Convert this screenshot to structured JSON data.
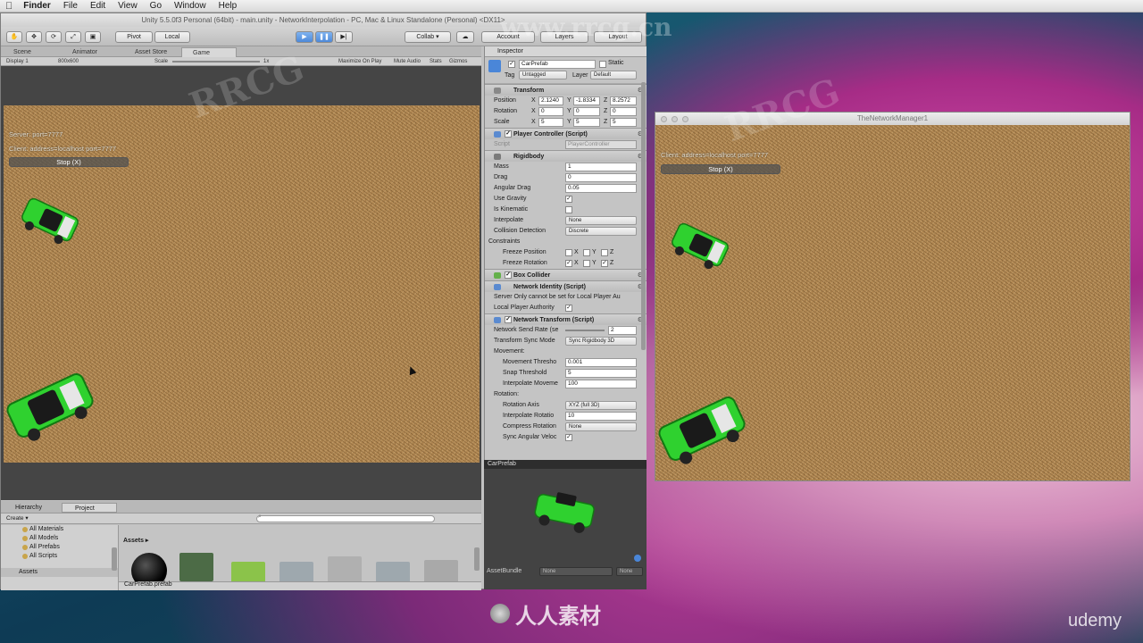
{
  "menubar": {
    "app": "Finder",
    "items": [
      "File",
      "Edit",
      "View",
      "Go",
      "Window",
      "Help"
    ]
  },
  "unity": {
    "window_title": "Unity 5.5.0f3 Personal (64bit) - main.unity - NetworkInterpolation - PC, Mac & Linux Standalone (Personal) <DX11>",
    "toolbar": {
      "pivot": "Pivot",
      "local": "Local",
      "collab": "Collab ▾",
      "account": "Account",
      "layers": "Layers",
      "layout": "Layout"
    },
    "tabs": {
      "scene": "Scene",
      "animator": "Animator",
      "asset_store": "Asset Store",
      "game": "Game"
    },
    "gamebar": {
      "display": "Display 1",
      "resolution": "800x600",
      "scale_label": "Scale",
      "scale_value": "1x",
      "maximize": "Maximize On Play",
      "mute": "Mute Audio",
      "stats": "Stats",
      "gizmos": "Gizmos"
    },
    "game_hud": {
      "server": "Server: port=7777",
      "client": "Client: address=localhost port=7777",
      "stop": "Stop (X)"
    }
  },
  "inspector": {
    "tab": "Inspector",
    "object_name": "CarPrefab",
    "static_label": "Static",
    "tag_label": "Tag",
    "tag_value": "Untagged",
    "layer_label": "Layer",
    "layer_value": "Default",
    "transform": {
      "title": "Transform",
      "position_label": "Position",
      "rotation_label": "Rotation",
      "scale_label": "Scale",
      "position": [
        "2.1240",
        "-1.8334",
        "8.2572"
      ],
      "rotation": [
        "0",
        "0",
        "0"
      ],
      "scale": [
        "5",
        "5",
        "5"
      ]
    },
    "player_controller": {
      "title": "Player Controller (Script)",
      "script_label": "Script",
      "script_value": "PlayerController"
    },
    "rigidbody": {
      "title": "Rigidbody",
      "mass_label": "Mass",
      "mass": "1",
      "drag_label": "Drag",
      "drag": "0",
      "angular_drag_label": "Angular Drag",
      "angular_drag": "0.05",
      "use_gravity": "Use Gravity",
      "is_kinematic": "Is Kinematic",
      "interpolate_label": "Interpolate",
      "interpolate": "None",
      "collision_label": "Collision Detection",
      "collision": "Discrete",
      "constraints": "Constraints",
      "freeze_position": "Freeze Position",
      "freeze_rotation": "Freeze Rotation"
    },
    "box_collider": {
      "title": "Box Collider"
    },
    "network_identity": {
      "title": "Network Identity (Script)",
      "server_only": "Server Only cannot be set for Local Player Au",
      "local_authority": "Local Player Authority"
    },
    "network_transform": {
      "title": "Network Transform (Script)",
      "send_rate_label": "Network Send Rate (se",
      "send_rate": "2",
      "sync_mode_label": "Transform Sync Mode",
      "sync_mode": "Sync Rigidbody 3D",
      "movement": "Movement:",
      "movement_threshold_label": "Movement Thresho",
      "movement_threshold": "0.001",
      "snap_threshold_label": "Snap Threshold",
      "snap_threshold": "5",
      "interp_movement_label": "Interpolate Moveme",
      "interp_movement": "100",
      "rotation": "Rotation:",
      "rotation_axis_label": "Rotation Axis",
      "rotation_axis": "XYZ (full 3D)",
      "interp_rotation_label": "Interpolate Rotatio",
      "interp_rotation": "10",
      "compress_label": "Compress Rotation",
      "compress": "None",
      "sync_angular_label": "Sync Angular Veloc"
    },
    "axes": [
      "X",
      "Y",
      "Z"
    ]
  },
  "preview": {
    "title": "CarPrefab",
    "assetbundle": "AssetBundle",
    "none1": "None",
    "none2": "None"
  },
  "bottom": {
    "hierarchy_tab": "Hierarchy",
    "project_tab": "Project",
    "create": "Create ▾",
    "favorites": [
      "All Materials",
      "All Models",
      "All Prefabs",
      "All Scripts"
    ],
    "assets_root": "Assets",
    "breadcrumb": "Assets ▸",
    "selected_file": "CarPrefab.prefab"
  },
  "netwin": {
    "title": "TheNetworkManager1",
    "client": "Client: address=localhost port=7777",
    "stop": "Stop (X)"
  },
  "overlay": {
    "watermark1": "RRCG",
    "watermark2": "www.rrcg.cn",
    "logo_text": "人人素材",
    "udemy": "udemy"
  }
}
